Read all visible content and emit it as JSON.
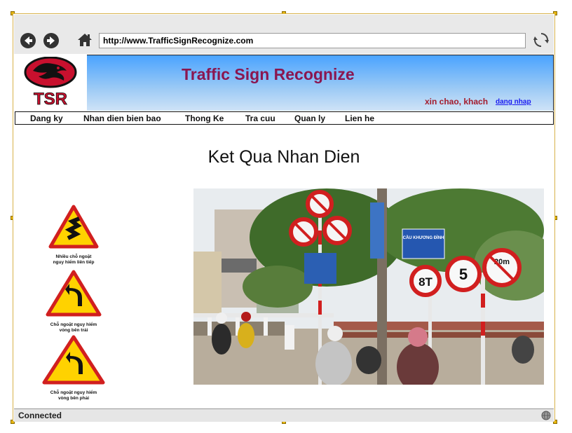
{
  "browser": {
    "url": "http://www.TrafficSignRecognize.com",
    "status": "Connected"
  },
  "header": {
    "logo_text": "TSR",
    "title": "Traffic Sign Recognize",
    "greeting": "xin chao, khach",
    "login_link": "dang nhap"
  },
  "menu": [
    {
      "label": "Dang ky"
    },
    {
      "label": "Nhan dien bien bao"
    },
    {
      "label": "Thong Ke"
    },
    {
      "label": "Tra cuu"
    },
    {
      "label": "Quan ly"
    },
    {
      "label": "Lien he"
    }
  ],
  "main": {
    "title": "Ket Qua Nhan Dien",
    "signs": [
      {
        "caption_line1": "Nhiều chỗ ngoặt",
        "caption_line2": "nguy hiểm liên tiếp"
      },
      {
        "caption_line1": "Chỗ ngoặt nguy hiểm",
        "caption_line2": "vòng bên trái"
      },
      {
        "caption_line1": "Chỗ ngoặt nguy hiểm",
        "caption_line2": "vòng bên phải"
      }
    ],
    "photo_signs": {
      "bridge_sign": "CẦU KHƯƠNG ĐÌNH",
      "weight_limit": "8T",
      "speed_limit": "5",
      "length_limit": "20m"
    }
  },
  "colors": {
    "title": "#8a1650",
    "greeting": "#a41c2c",
    "banner_top": "#4aa3ff",
    "banner_bottom": "#cfe3f7"
  }
}
